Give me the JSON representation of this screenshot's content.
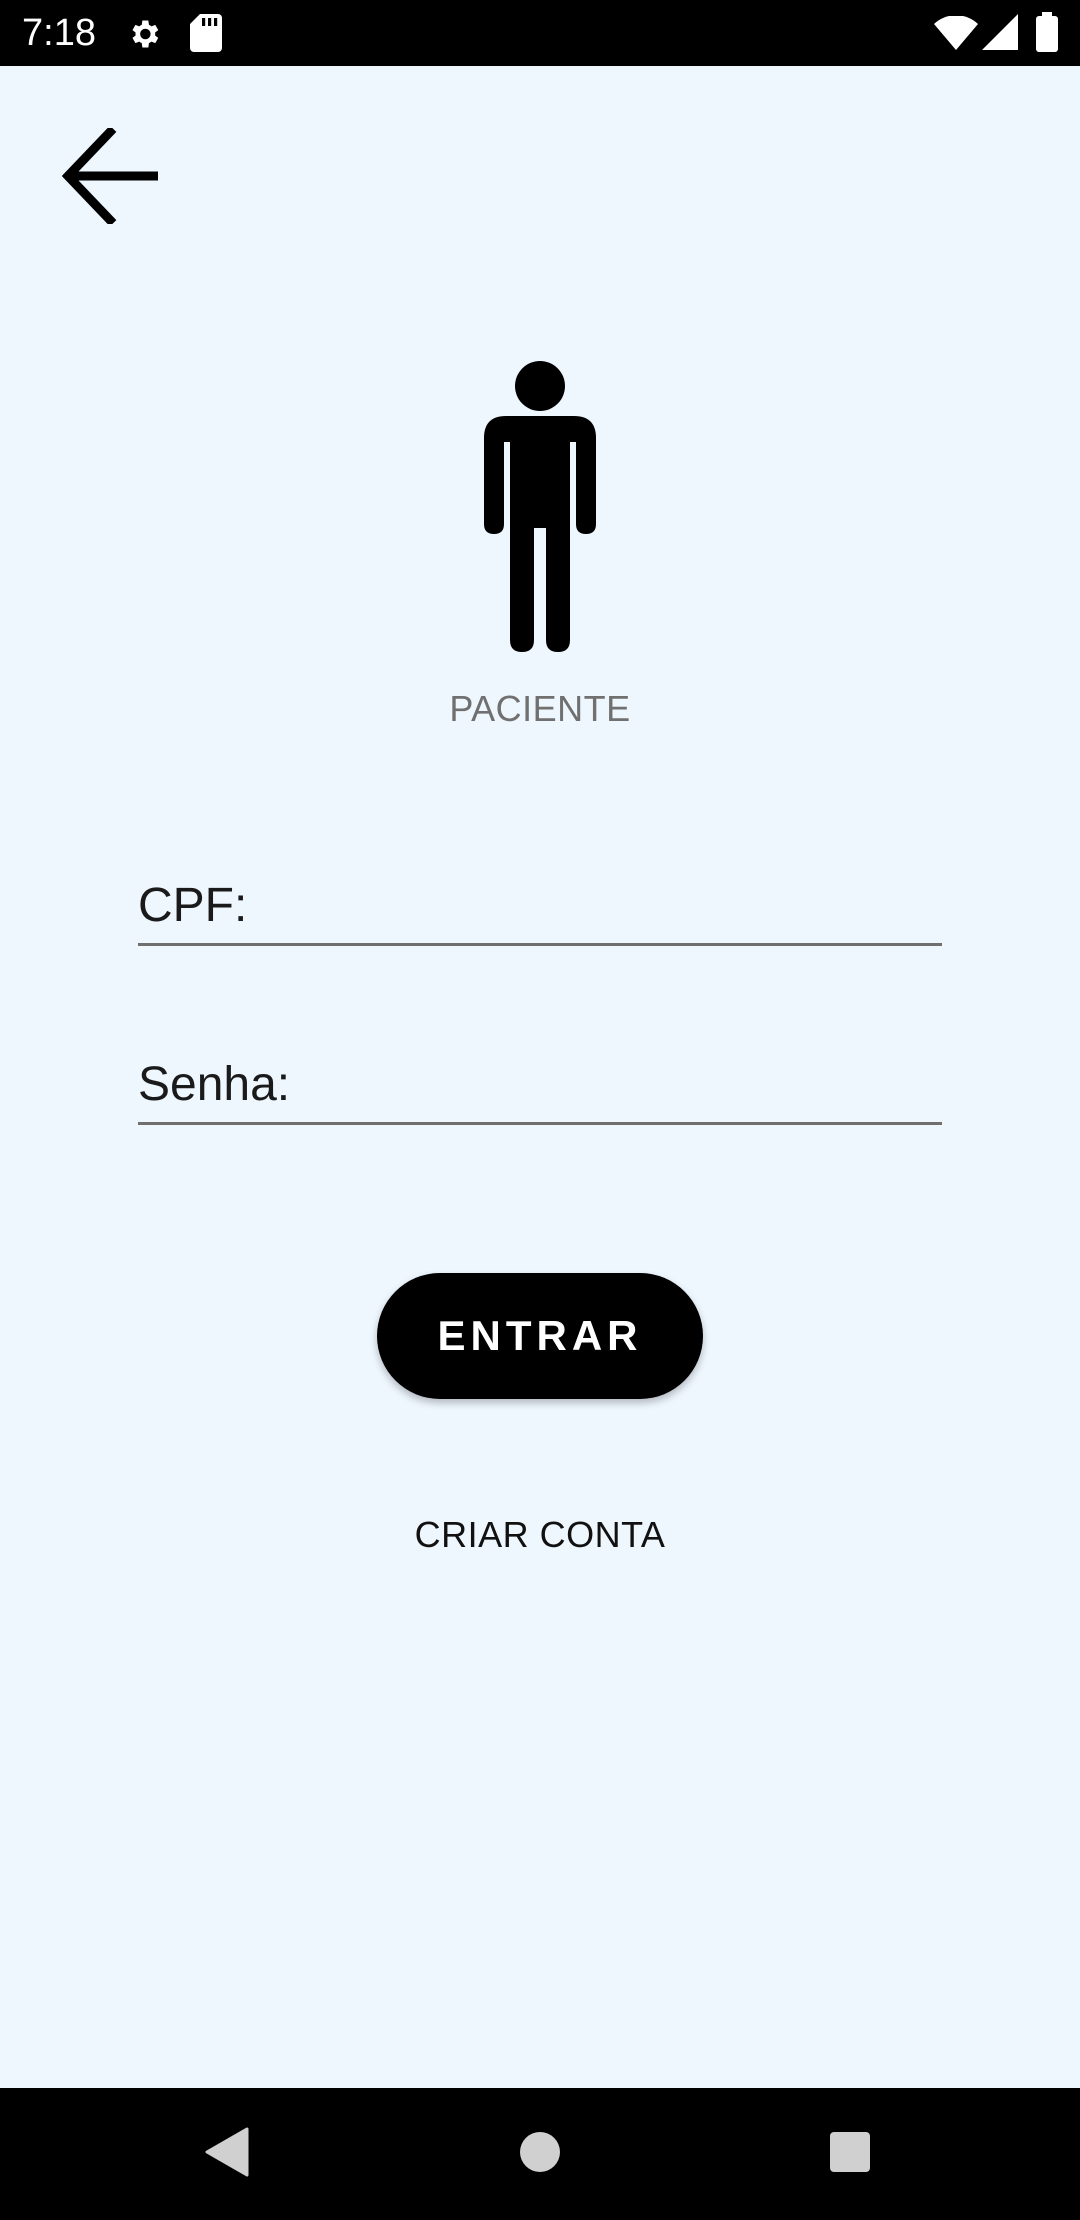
{
  "status_bar": {
    "time": "7:18",
    "icons": [
      "settings-icon",
      "sd-card-icon",
      "wifi-icon",
      "signal-icon",
      "battery-icon"
    ]
  },
  "header": {
    "back_icon": "arrow-left-icon"
  },
  "profile": {
    "icon": "person-icon",
    "role_label": "PACIENTE"
  },
  "form": {
    "cpf_placeholder": "CPF:",
    "cpf_value": "",
    "password_placeholder": "Senha:",
    "password_value": "",
    "login_label": "ENTRAR",
    "create_account_label": "CRIAR CONTA"
  },
  "nav_bar": {
    "icons": [
      "back-triangle-icon",
      "home-circle-icon",
      "recents-square-icon"
    ]
  },
  "colors": {
    "background": "#eef6fe",
    "primary": "#000000",
    "muted_text": "#707070",
    "underline": "#6f6f6f"
  }
}
